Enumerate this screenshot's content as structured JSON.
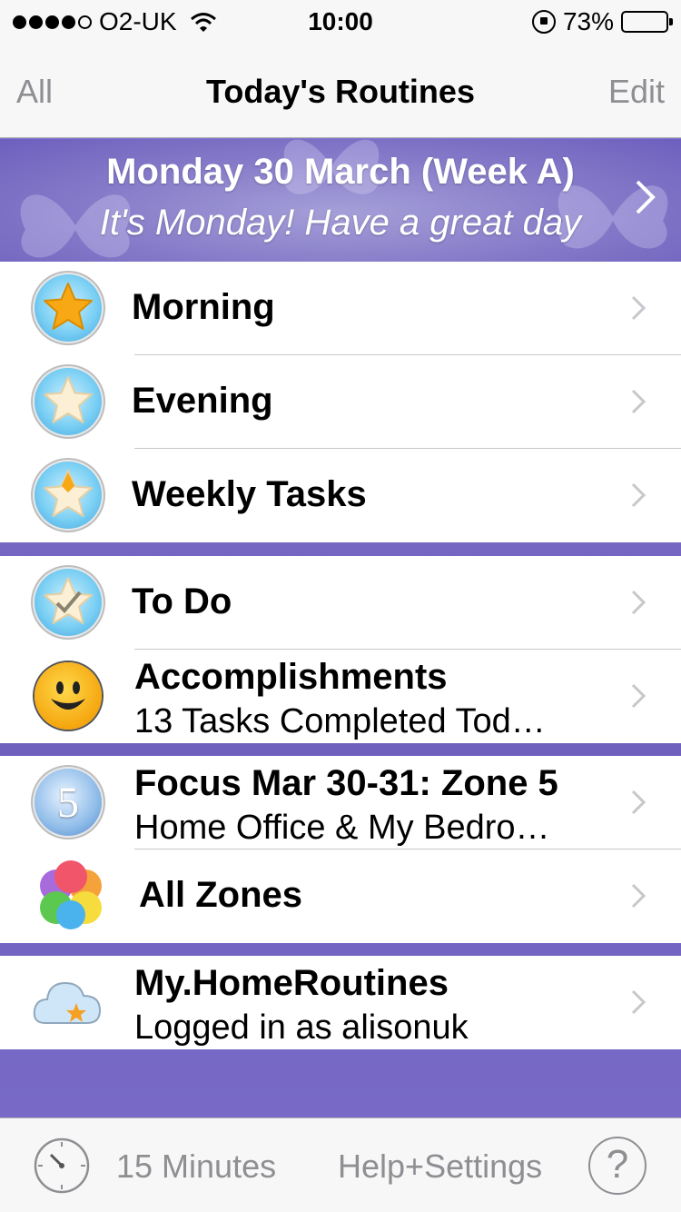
{
  "status_bar": {
    "carrier": "O2-UK",
    "time": "10:00",
    "battery": "73%",
    "battery_level": 0.73
  },
  "nav": {
    "left": "All",
    "title": "Today's Routines",
    "right": "Edit"
  },
  "banner": {
    "date": "Monday 30 March (Week A)",
    "message": "It's Monday! Have a great day"
  },
  "routines": [
    {
      "label": "Morning",
      "icon": "star-icon"
    },
    {
      "label": "Evening",
      "icon": "star-icon"
    },
    {
      "label": "Weekly Tasks",
      "icon": "star-icon"
    }
  ],
  "todo": {
    "label": "To Do",
    "icon": "checkmark-star-icon"
  },
  "accomplishments": {
    "title": "Accomplishments",
    "subtitle": "13 Tasks Completed Tod…",
    "icon": "smiley-icon"
  },
  "focus": {
    "title": "Focus Mar 30-31: Zone 5",
    "subtitle": "Home Office & My Bedro…",
    "zone_number": "5"
  },
  "all_zones": {
    "label": "All Zones",
    "icon": "color-circles-icon"
  },
  "account": {
    "title": "My.HomeRoutines",
    "subtitle": "Logged in as alisonuk",
    "icon": "cloud-icon"
  },
  "tab_bar": {
    "timer_label": "15 Minutes",
    "help_label": "Help+Settings",
    "question": "?"
  },
  "colors": {
    "accent_purple": "#7e6fc9",
    "nav_gray": "#8e8e93",
    "star_blue": "#3fa6e0"
  }
}
